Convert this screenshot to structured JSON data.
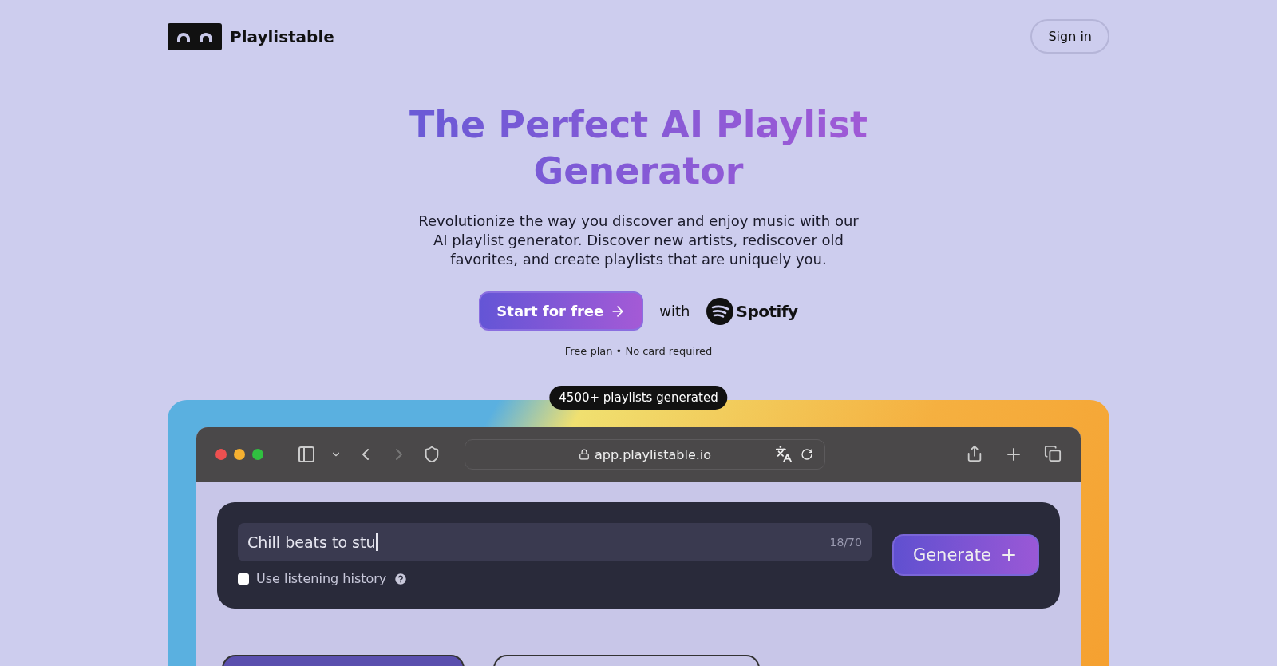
{
  "header": {
    "brand": "Playlistable",
    "sign_in": "Sign in"
  },
  "hero": {
    "title_line_1": "The Perfect AI Playlist",
    "title_line_2": "Generator",
    "description": "Revolutionize the way you discover and enjoy music with our AI playlist generator. Discover new artists, rediscover old favorites, and create playlists that are uniquely you.",
    "cta": "Start for free",
    "with": "with",
    "partner": "Spotify",
    "note": "Free plan • No card required"
  },
  "badge": "4500+ playlists generated",
  "browser": {
    "url": "app.playlistable.io"
  },
  "generator": {
    "prompt": "Chill beats to stu",
    "counter": "18/70",
    "history_label": "Use listening history",
    "history_checked": false,
    "button": "Generate"
  }
}
